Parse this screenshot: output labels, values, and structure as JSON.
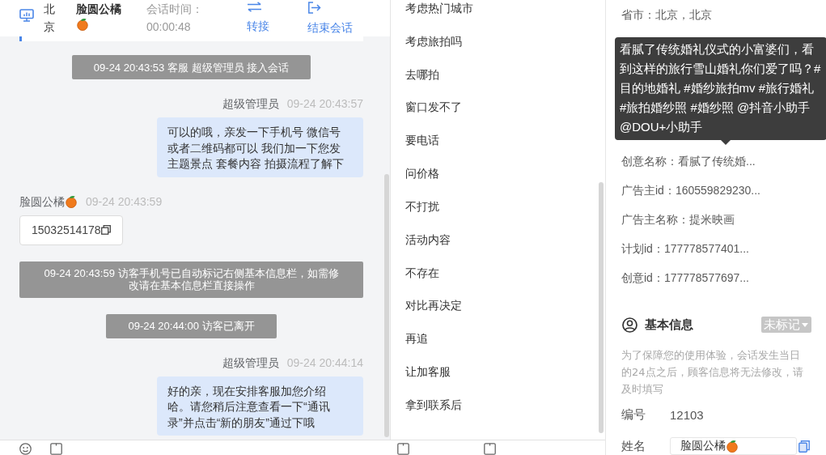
{
  "header": {
    "location": "北京",
    "customer_name": "脸圆公橘",
    "session_time_label": "会话时间：",
    "session_time": "00:00:48",
    "actions": [
      {
        "kind": "transfer",
        "label": "转接"
      },
      {
        "kind": "end",
        "label": "结束会话"
      }
    ]
  },
  "messages": [
    {
      "kind": "system",
      "text": "09-24 20:43:53 客服 超级管理员 接入会话"
    },
    {
      "kind": "agent",
      "sender": "超级管理员",
      "time": "09-24 20:43:57",
      "text": "可以的哦，亲发一下手机号 微信号或者二维码都可以 我们加一下您发主题景点 套餐内容 拍摄流程了解下"
    },
    {
      "kind": "customer",
      "sender": "脸圆公橘",
      "time": "09-24 20:43:59",
      "text": "15032514178"
    },
    {
      "kind": "system",
      "text": "09-24 20:43:59 访客手机号已自动标记右侧基本信息栏，如需修改请在基本信息栏直接操作"
    },
    {
      "kind": "system",
      "text": "09-24 20:44:00 访客已离开"
    },
    {
      "kind": "agent",
      "sender": "超级管理员",
      "time": "09-24 20:44:14",
      "text": "好的亲，现在安排客服加您介绍哈。请您稍后注意查看一下“通讯录”并点击“新的朋友”通过下哦"
    }
  ],
  "quick_replies": [
    "考虑热门城市",
    "考虑旅拍吗",
    "去哪拍",
    "窗口发不了",
    "要电话",
    "问价格",
    "不打扰",
    "活动内容",
    "不存在",
    "对比再决定",
    "再追",
    "让加客服",
    "拿到联系后"
  ],
  "info_items": [
    {
      "kind": "row",
      "text": "省市：北京，北京"
    },
    {
      "kind": "tooltip",
      "text": "看腻了传统婚礼仪式的小富婆们，看到这样的旅行雪山婚礼你们爱了吗？#目的地婚礼 #婚纱旅拍mv #旅行婚礼 #旅拍婚纱照 #婚纱照 @抖音小助手 @DOU+小助手"
    },
    {
      "kind": "row",
      "text": "创意名称：看腻了传统婚..."
    },
    {
      "kind": "row",
      "text": "广告主id：160559829230..."
    },
    {
      "kind": "row",
      "text": "广告主名称：提米映画"
    },
    {
      "kind": "row",
      "text": "计划id：177778577401..."
    },
    {
      "kind": "row",
      "text": "创意id：177778577697..."
    }
  ],
  "basic_info": {
    "title": "基本信息",
    "tag": "未标记",
    "hint": "为了保障您的使用体验，会话发生当日的24点之后，顾客信息将无法修改，请及时填写",
    "fields": [
      {
        "kind": "text",
        "label": "编号",
        "value": "12103"
      },
      {
        "kind": "input",
        "label": "姓名",
        "value": "脸圆公橘"
      }
    ]
  }
}
